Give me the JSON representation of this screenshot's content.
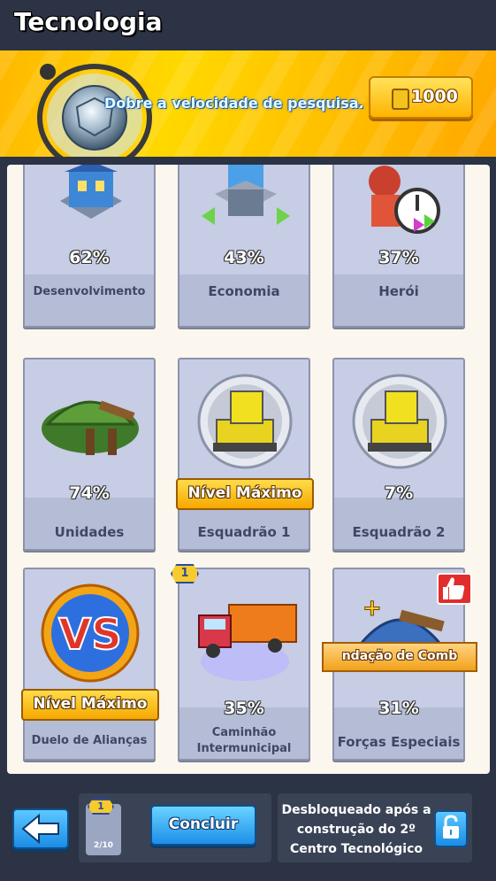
{
  "header": {
    "title": "Tecnologia"
  },
  "banner": {
    "text": "Dobre a velocidade de pesquisa.",
    "price": "1000"
  },
  "cards": [
    {
      "label": "Desenvolvimento",
      "percent": "62%"
    },
    {
      "label": "Economia",
      "percent": "43%"
    },
    {
      "label": "Herói",
      "percent": "37%"
    },
    {
      "label": "Unidades",
      "percent": "74%"
    },
    {
      "label": "Esquadrão 1",
      "status": "Nível Máximo"
    },
    {
      "label": "Esquadrão 2",
      "percent": "7%"
    },
    {
      "label": "Duelo de Alianças",
      "status": "Nível Máximo"
    },
    {
      "label": "Caminhão Intermunicipal",
      "percent": "35%",
      "badge": "1"
    },
    {
      "label": "Forças Especiais",
      "percent": "31%",
      "ribbon": "ndação de Comb"
    }
  ],
  "bottom": {
    "slot_badge": "1",
    "slot_count": "2/10",
    "conclude_label": "Concluir",
    "unlock_text": "Desbloqueado após a construção do 2º Centro Tecnológico"
  },
  "colors": {
    "accent_yellow": "#ffc400",
    "button_blue": "#1b8de6",
    "card_bg": "#c6cde4",
    "panel_bg": "#fbf7ee"
  }
}
